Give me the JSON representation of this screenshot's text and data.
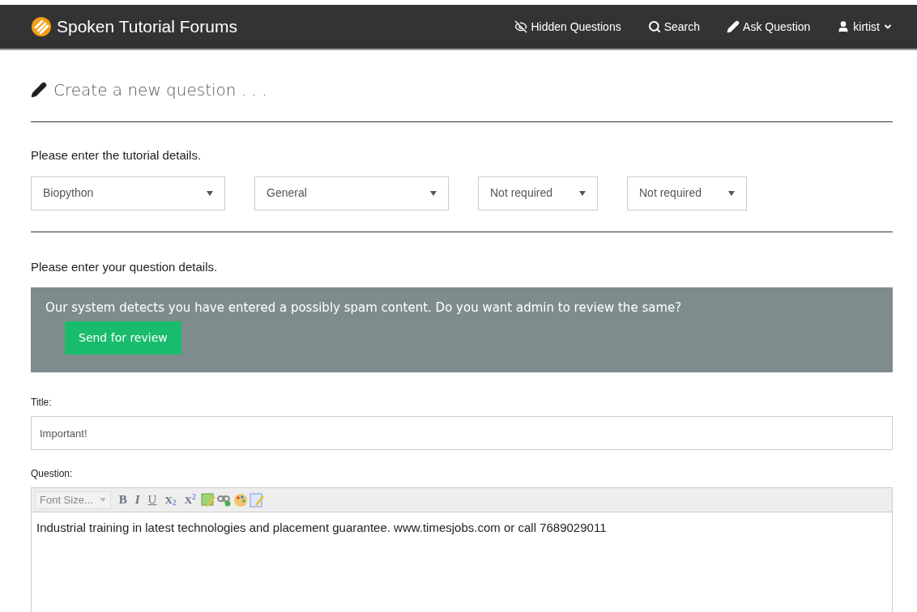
{
  "navbar": {
    "brand": "Spoken Tutorial Forums",
    "links": [
      {
        "kind": "hidden",
        "label": "Hidden Questions"
      },
      {
        "kind": "search",
        "label": "Search"
      },
      {
        "kind": "ask",
        "label": "Ask Question"
      },
      {
        "kind": "user",
        "label": "kirtist"
      }
    ]
  },
  "heading": "Create a new question . . .",
  "tutorial_section": {
    "label": "Please enter the tutorial details.",
    "selects": [
      {
        "value": "Biopython"
      },
      {
        "value": "General"
      },
      {
        "value": "Not required"
      },
      {
        "value": "Not required"
      }
    ]
  },
  "question_section": {
    "label": "Please enter your question details."
  },
  "spam_alert": {
    "message": "Our system detects you have entered a possibly spam content. Do you want admin to review the same?",
    "button": "Send for review"
  },
  "title_field": {
    "label": "Title:",
    "value": "Important!"
  },
  "question_field": {
    "label": "Question:",
    "font_size": "Font Size...",
    "toolbar": [
      {
        "kind": "bold",
        "text": "B"
      },
      {
        "kind": "italic",
        "text": "I"
      },
      {
        "kind": "underline",
        "text": "U"
      },
      {
        "kind": "script",
        "text": "X$_{2}$"
      },
      {
        "kind": "script",
        "text": "X$^{2}$"
      },
      {
        "kind": "image"
      },
      {
        "kind": "link"
      },
      {
        "kind": "palette"
      },
      {
        "kind": "edit"
      }
    ],
    "value": "Industrial training in latest technologies and placement guarantee. www.timesjobs.com or call 7689029011"
  }
}
